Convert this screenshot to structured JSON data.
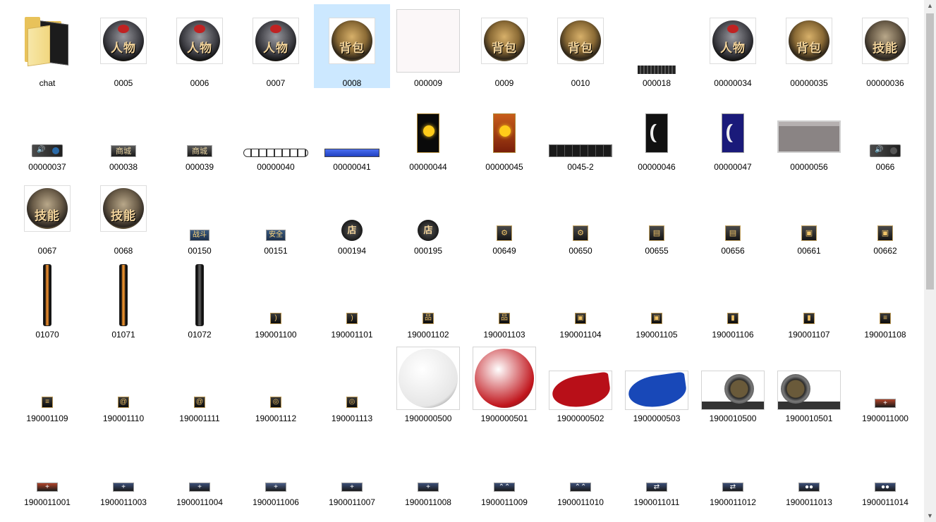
{
  "files": [
    {
      "name": "chat",
      "kind": "folder"
    },
    {
      "name": "0005",
      "kind": "char",
      "variant": "person",
      "caption": "人物"
    },
    {
      "name": "0006",
      "kind": "char",
      "variant": "person",
      "caption": "人物"
    },
    {
      "name": "0007",
      "kind": "char",
      "variant": "person",
      "caption": "人物"
    },
    {
      "name": "0008",
      "kind": "char",
      "variant": "bag",
      "caption": "背包",
      "selected": true
    },
    {
      "name": "000009",
      "kind": "blank"
    },
    {
      "name": "0009",
      "kind": "char",
      "variant": "bag",
      "caption": "背包"
    },
    {
      "name": "0010",
      "kind": "char",
      "variant": "bag",
      "caption": "背包"
    },
    {
      "name": "000018",
      "kind": "strip"
    },
    {
      "name": "00000034",
      "kind": "char",
      "variant": "person",
      "caption": "人物"
    },
    {
      "name": "00000035",
      "kind": "char",
      "variant": "bag",
      "caption": "背包"
    },
    {
      "name": "00000036",
      "kind": "char",
      "variant": "skill",
      "caption": "技能"
    },
    {
      "name": "00000037",
      "kind": "speaker"
    },
    {
      "name": "000038",
      "kind": "btnsmall",
      "caption": "商城"
    },
    {
      "name": "000039",
      "kind": "btnsmall",
      "caption": "商城"
    },
    {
      "name": "00000040",
      "kind": "chain"
    },
    {
      "name": "00000041",
      "kind": "bluebar"
    },
    {
      "name": "00000044",
      "kind": "sun"
    },
    {
      "name": "00000045",
      "kind": "sunred"
    },
    {
      "name": "0045-2",
      "kind": "slots"
    },
    {
      "name": "00000046",
      "kind": "moon"
    },
    {
      "name": "00000047",
      "kind": "moonblue"
    },
    {
      "name": "00000056",
      "kind": "panel"
    },
    {
      "name": "0066",
      "kind": "speaker2"
    },
    {
      "name": "0067",
      "kind": "char",
      "variant": "skill",
      "caption": "技能"
    },
    {
      "name": "0068",
      "kind": "char",
      "variant": "skill",
      "caption": "技能"
    },
    {
      "name": "00150",
      "kind": "btnblue",
      "caption": "战斗"
    },
    {
      "name": "00151",
      "kind": "btnblue",
      "caption": "安全"
    },
    {
      "name": "000194",
      "kind": "roundbtn",
      "caption": "店"
    },
    {
      "name": "000195",
      "kind": "roundbtn",
      "caption": "店"
    },
    {
      "name": "00649",
      "kind": "sq",
      "caption": "⚙"
    },
    {
      "name": "00650",
      "kind": "sq",
      "caption": "⚙"
    },
    {
      "name": "00655",
      "kind": "sq",
      "caption": "▤"
    },
    {
      "name": "00656",
      "kind": "sq",
      "caption": "▤"
    },
    {
      "name": "00661",
      "kind": "sq",
      "caption": "▣"
    },
    {
      "name": "00662",
      "kind": "sq",
      "caption": "▣"
    },
    {
      "name": "01070",
      "kind": "vbar",
      "color": "#d9822b"
    },
    {
      "name": "01071",
      "kind": "vbar",
      "color": "#e08a2c"
    },
    {
      "name": "01072",
      "kind": "vbar",
      "color": "#555555"
    },
    {
      "name": "190001100",
      "kind": "tiny",
      "caption": ")"
    },
    {
      "name": "190001101",
      "kind": "tiny",
      "caption": ")"
    },
    {
      "name": "190001102",
      "kind": "tiny",
      "caption": "品"
    },
    {
      "name": "190001103",
      "kind": "tiny",
      "caption": "品"
    },
    {
      "name": "190001104",
      "kind": "tiny",
      "caption": "▣"
    },
    {
      "name": "190001105",
      "kind": "tiny",
      "caption": "▣"
    },
    {
      "name": "190001106",
      "kind": "tiny",
      "caption": "▮"
    },
    {
      "name": "190001107",
      "kind": "tiny",
      "caption": "▮"
    },
    {
      "name": "190001108",
      "kind": "tiny",
      "caption": "≡"
    },
    {
      "name": "190001109",
      "kind": "tiny",
      "caption": "≡"
    },
    {
      "name": "190001110",
      "kind": "tiny",
      "caption": "@"
    },
    {
      "name": "190001111",
      "kind": "tiny",
      "caption": "@"
    },
    {
      "name": "190001112",
      "kind": "tiny",
      "caption": "◎"
    },
    {
      "name": "190001113",
      "kind": "tiny",
      "caption": "◎"
    },
    {
      "name": "1900000500",
      "kind": "orb",
      "color": "#e6e6e6"
    },
    {
      "name": "1900000501",
      "kind": "orb",
      "color": "#c0141b"
    },
    {
      "name": "1900000502",
      "kind": "wave",
      "color": "#b80f18"
    },
    {
      "name": "1900000503",
      "kind": "wave",
      "color": "#1848b8"
    },
    {
      "name": "1900010500",
      "kind": "machine"
    },
    {
      "name": "1900010501",
      "kind": "machine2"
    },
    {
      "name": "1900011000",
      "kind": "wide",
      "color": "#b0442a",
      "caption": "+"
    },
    {
      "name": "1900011001",
      "kind": "wide",
      "color": "#b0442a",
      "caption": "+"
    },
    {
      "name": "1900011003",
      "kind": "wide",
      "color": "#3a4e78",
      "caption": "+"
    },
    {
      "name": "1900011004",
      "kind": "wide",
      "color": "#3a4e78",
      "caption": "+"
    },
    {
      "name": "1900011006",
      "kind": "wide",
      "color": "#4a5e88",
      "caption": "+"
    },
    {
      "name": "1900011007",
      "kind": "wide",
      "color": "#3a4e78",
      "caption": "+"
    },
    {
      "name": "1900011008",
      "kind": "wide",
      "color": "#3a4e78",
      "caption": "+"
    },
    {
      "name": "1900011009",
      "kind": "wide",
      "color": "#3a4e78",
      "caption": "⌃⌃"
    },
    {
      "name": "1900011010",
      "kind": "wide",
      "color": "#3a4e78",
      "caption": "⌃⌃"
    },
    {
      "name": "1900011011",
      "kind": "wide",
      "color": "#3a4e78",
      "caption": "⇄"
    },
    {
      "name": "1900011012",
      "kind": "wide",
      "color": "#3a4e78",
      "caption": "⇄"
    },
    {
      "name": "1900011013",
      "kind": "wide",
      "color": "#3a4e78",
      "caption": "●●"
    },
    {
      "name": "1900011014",
      "kind": "wide",
      "color": "#3a4e78",
      "caption": "●●"
    }
  ],
  "scrollbar": {
    "up_arrow": "▲",
    "down_arrow": "▼"
  }
}
